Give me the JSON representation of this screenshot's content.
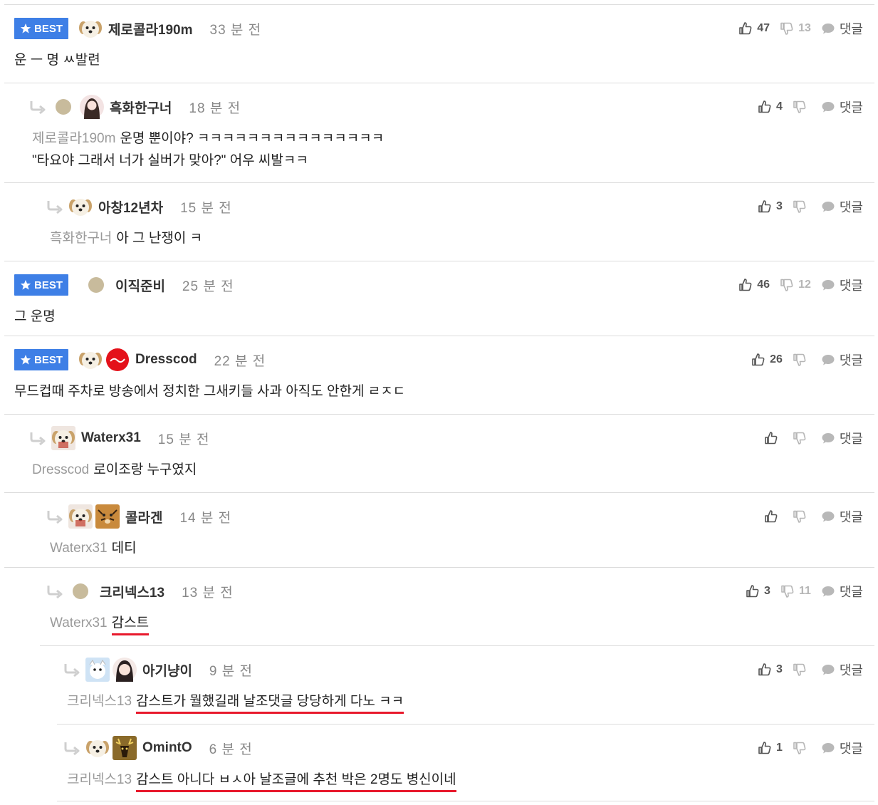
{
  "labels": {
    "best": "BEST",
    "reply": "댓글"
  },
  "comments": [
    {
      "best": true,
      "nick": "제로콜라190m",
      "time": "33 분 전",
      "up": "47",
      "down": "13",
      "mention": "",
      "text": "운 ㅡ 명 ㅆ발련"
    },
    {
      "best": false,
      "nick": "흑화한구너",
      "time": "18 분 전",
      "up": "4",
      "down": "",
      "mention": "제로콜라190m",
      "text": "운명 뿐이야? ㅋㅋㅋㅋㅋㅋㅋㅋㅋㅋㅋㅋㅋㅋㅋ",
      "text2": "\"타요야 그래서 너가 실버가 맞아?\" 어우 씨발ㅋㅋ"
    },
    {
      "best": false,
      "nick": "아창12년차",
      "time": "15 분 전",
      "up": "3",
      "down": "",
      "mention": "흑화한구너",
      "text": "아 그 난쟁이 ㅋ"
    },
    {
      "best": true,
      "nick": "이직준비",
      "time": "25 분 전",
      "up": "46",
      "down": "12",
      "mention": "",
      "text": "그 운명"
    },
    {
      "best": true,
      "nick": "Dresscod",
      "time": "22 분 전",
      "up": "26",
      "down": "",
      "mention": "",
      "text": "무드컵때 주차로 방송에서 정치한 그새키들 사과 아직도 안한게 ㄹㅈㄷ"
    },
    {
      "best": false,
      "nick": "Waterx31",
      "time": "15 분 전",
      "up": "",
      "down": "",
      "mention": "Dresscod",
      "text": "로이조랑 누구였지"
    },
    {
      "best": false,
      "nick": "콜라겐",
      "time": "14 분 전",
      "up": "",
      "down": "",
      "mention": "Waterx31",
      "text": "데티"
    },
    {
      "best": false,
      "nick": "크리넥스13",
      "time": "13 분 전",
      "up": "3",
      "down": "11",
      "mention": "Waterx31",
      "text": "감스트"
    },
    {
      "best": false,
      "nick": "아기냥이",
      "time": "9 분 전",
      "up": "3",
      "down": "",
      "mention": "크리넥스13",
      "text": "감스트가 뭘했길래 날조댓글 당당하게 다노 ㅋㅋ"
    },
    {
      "best": false,
      "nick": "OmintO",
      "time": "6 분 전",
      "up": "1",
      "down": "",
      "mention": "크리넥스13",
      "text": "감스트 아니다 ㅂㅅ아 날조글에 추천 박은 2명도 병신이네"
    }
  ],
  "colors": {
    "best_badge": "#3e7fe6",
    "underline": "#e8192c",
    "mention": "#9a9a9a"
  }
}
